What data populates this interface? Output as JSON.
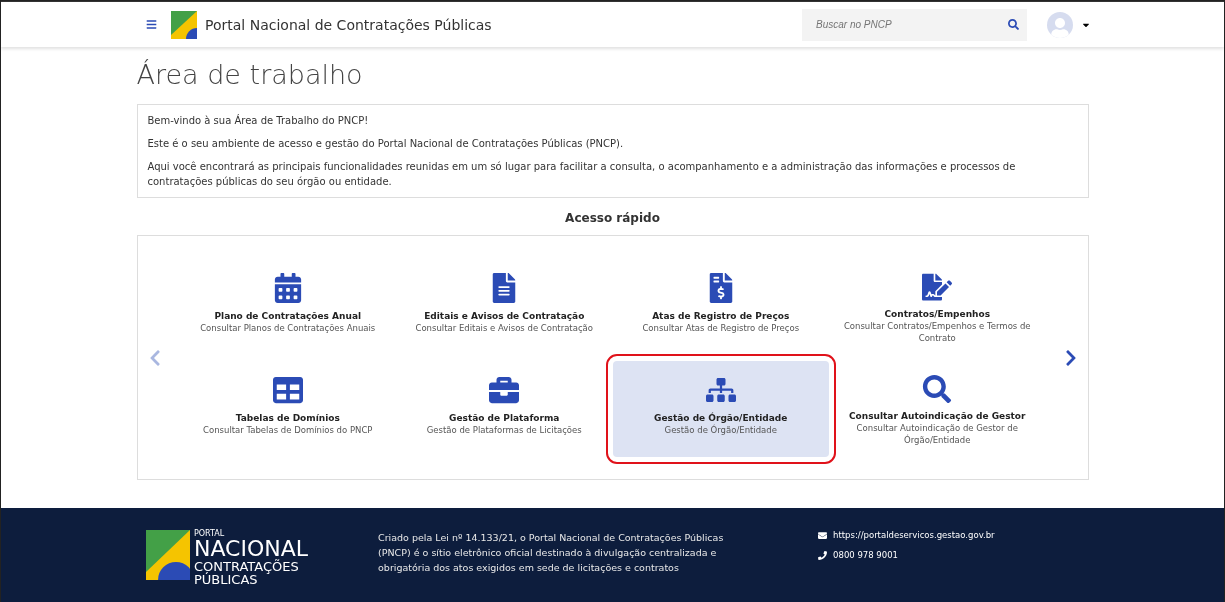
{
  "header": {
    "title": "Portal Nacional de Contratações Públicas",
    "search": {
      "placeholder": "Buscar no PNCP"
    }
  },
  "page_title": "Área de trabalho",
  "intro": [
    "Bem-vindo à sua Área de Trabalho do PNCP!",
    "Este é o seu ambiente de acesso e gestão do Portal Nacional de Contratações Públicas (PNCP).",
    "Aqui você encontrará as principais funcionalidades reunidas em um só lugar para facilitar a consulta, o acompanhamento e a administração das informações e processos de contratações públicas do seu órgão ou entidade."
  ],
  "quick_access": {
    "title": "Acesso rápido",
    "items": [
      {
        "title": "Plano de Contratações Anual",
        "subtitle": "Consultar Planos de Contratações Anuais",
        "selected": false
      },
      {
        "title": "Editais e Avisos de Contratação",
        "subtitle": "Consultar Editais e Avisos de Contratação",
        "selected": false
      },
      {
        "title": "Atas de Registro de Preços",
        "subtitle": "Consultar Atas de Registro de Preços",
        "selected": false
      },
      {
        "title": "Contratos/Empenhos",
        "subtitle": "Consultar Contratos/Empenhos e Termos de Contrato",
        "selected": false
      },
      {
        "title": "Tabelas de Domínios",
        "subtitle": "Consultar Tabelas de Domínios do PNCP",
        "selected": false
      },
      {
        "title": "Gestão de Plataforma",
        "subtitle": "Gestão de Plataformas de Licitações",
        "selected": false
      },
      {
        "title": "Gestão de Órgão/Entidade",
        "subtitle": "Gestão de Órgão/Entidade",
        "selected": true
      },
      {
        "title": "Consultar Autoindicação de Gestor",
        "subtitle": "Consultar Autoindicação de Gestor de Órgão/Entidade",
        "selected": false
      }
    ]
  },
  "footer": {
    "logo": [
      "PORTAL",
      "NACIONAL",
      "CONTRATAÇÕES",
      "PÚBLICAS"
    ],
    "text": "Criado pela Lei nº 14.133/21, o Portal Nacional de Contratações Públicas (PNCP) é o sítio eletrônico oficial destinado à divulgação centralizada e obrigatória dos atos exigidos em sede de licitações e contratos",
    "link": "https://portaldeservicos.gestao.gov.br",
    "phone": "0800 978 9001"
  }
}
